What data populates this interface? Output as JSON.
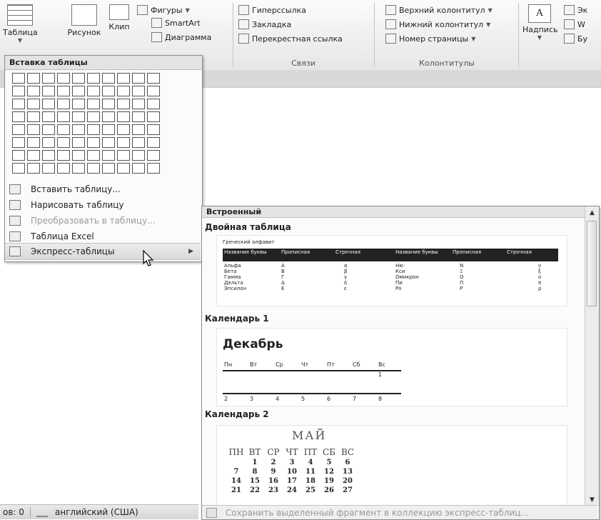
{
  "ribbon": {
    "table_label": "Таблица",
    "picture_label": "Рисунок",
    "clip_label": "Клип",
    "shapes_label": "Фигуры",
    "smartart_label": "SmartArt",
    "chart_label": "Диаграмма",
    "hyperlink_label": "Гиперссылка",
    "bookmark_label": "Закладка",
    "crossref_label": "Перекрестная ссылка",
    "links_group": "Связи",
    "header_label": "Верхний колонтитул",
    "footer_label": "Нижний колонтитул",
    "pagenum_label": "Номер страницы",
    "headers_group": "Колонтитулы",
    "textbox_label": "Надпись",
    "cut_1": "Эк",
    "cut_2": "W",
    "cut_3": "Бу"
  },
  "table_menu": {
    "title": "Вставка таблицы",
    "grid_cols": 10,
    "grid_rows": 8,
    "items": [
      {
        "label": "Вставить таблицу...",
        "disabled": false
      },
      {
        "label": "Нарисовать таблицу",
        "disabled": false
      },
      {
        "label": "Преобразовать в таблицу...",
        "disabled": true
      },
      {
        "label": "Таблица Excel",
        "disabled": false
      },
      {
        "label": "Экспресс-таблицы",
        "disabled": false,
        "submenu": true,
        "highlighted": true
      }
    ]
  },
  "gallery": {
    "header": "Встроенный",
    "sections": {
      "double": {
        "label": "Двойная таблица",
        "caption": "Греческий алфавит",
        "headers": [
          "Название буквы",
          "Прописная",
          "Строчная",
          "Название буквы",
          "Прописная",
          "Строчная"
        ],
        "rows": [
          [
            "Альфа",
            "А",
            "α",
            "Ню",
            "N",
            "ν"
          ],
          [
            "Бета",
            "В",
            "β",
            "Кси",
            "Ξ",
            "ξ"
          ],
          [
            "Гамма",
            "Г",
            "γ",
            "Омикрон",
            "О",
            "ο"
          ],
          [
            "Дельта",
            "Δ",
            "δ",
            "Пи",
            "П",
            "π"
          ],
          [
            "Эпсилон",
            "Е",
            "ε",
            "Ро",
            "Р",
            "ρ"
          ]
        ]
      },
      "calendar1": {
        "label": "Календарь 1",
        "month": "Декабрь",
        "days": [
          "Пн",
          "Вт",
          "Ср",
          "Чт",
          "Пт",
          "Сб",
          "Вс"
        ],
        "row1": [
          "",
          "",
          "",
          "",
          "",
          "",
          "1"
        ],
        "row2": [
          "2",
          "3",
          "4",
          "5",
          "6",
          "7",
          "8"
        ]
      },
      "calendar2": {
        "label": "Календарь 2",
        "month": "МАЙ",
        "days": [
          "ПН",
          "ВТ",
          "СР",
          "ЧТ",
          "ПТ",
          "СБ",
          "ВС"
        ],
        "weeks": [
          [
            "",
            "1",
            "2",
            "3",
            "4",
            "5",
            "6"
          ],
          [
            "7",
            "8",
            "9",
            "10",
            "11",
            "12",
            "13"
          ],
          [
            "14",
            "15",
            "16",
            "17",
            "18",
            "19",
            "20"
          ],
          [
            "21",
            "22",
            "23",
            "24",
            "25",
            "26",
            "27"
          ]
        ]
      }
    },
    "footer": "Сохранить выделенный фрагмент в коллекцию экспресс-таблиц..."
  },
  "status": {
    "words": "ов: 0",
    "language": "английский (США)"
  }
}
